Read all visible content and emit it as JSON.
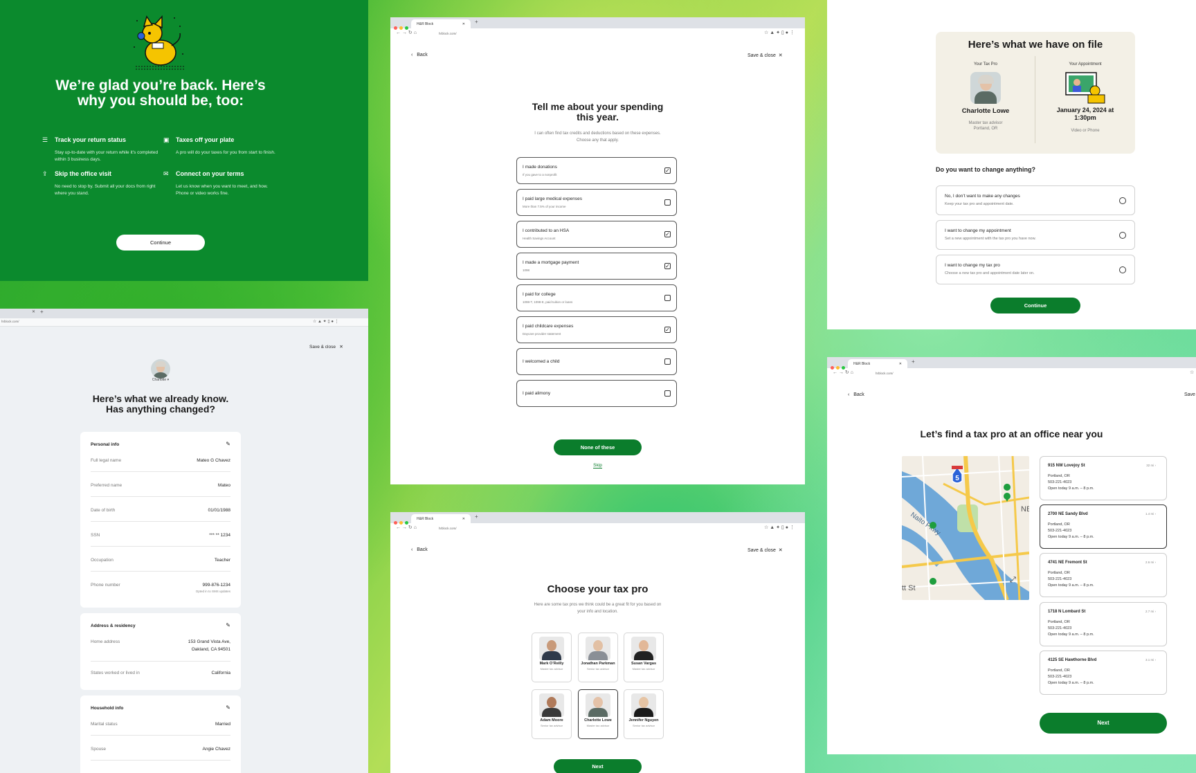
{
  "colors": {
    "brand_green": "#0b8a2d",
    "button_green": "#0b7d2c",
    "map_water": "#6fa8d8"
  },
  "welcome": {
    "title_line1": "We’re glad you’re back. Here’s",
    "title_line2": "why you should be, too:",
    "features": [
      {
        "icon": "checklist-icon",
        "title": "Track your return status",
        "desc": "Stay up-to-date with your return while it’s completed within 3 business days."
      },
      {
        "icon": "plate-icon",
        "title": "Taxes off your plate",
        "desc": "A pro will do your taxes for you from start to finish."
      },
      {
        "icon": "upload-icon",
        "title": "Skip the office visit",
        "desc": "No need to stop by. Submit all your docs from right where you stand."
      },
      {
        "icon": "chat-icon",
        "title": "Connect on your terms",
        "desc": "Let us know when you want to meet, and how. Phone or video works fine."
      }
    ],
    "continue_label": "Continue"
  },
  "browser": {
    "tab_title": "H&R Block",
    "url": "hrblock.com/"
  },
  "nav": {
    "back": "Back",
    "save_close": "Save & close",
    "save": "Save"
  },
  "spending": {
    "title_line1": "Tell me about your spending",
    "title_line2": "this year.",
    "subtitle_line1": "I can often find tax credits and deductions based on these expenses.",
    "subtitle_line2": "Choose any that apply.",
    "options": [
      {
        "title": "I made donations",
        "sub": "If you gave to a nonprofit",
        "checked": "✓"
      },
      {
        "title": "I paid large medical expenses",
        "sub": "More than 7.5% of your income",
        "checked": ""
      },
      {
        "title": "I contributed to an HSA",
        "sub": "Health Savings Account",
        "checked": "✓"
      },
      {
        "title": "I made a mortgage payment",
        "sub": "1098",
        "checked": "✓"
      },
      {
        "title": "I paid for college",
        "sub": "1098-T, 1098-E, paid tuition or loans",
        "checked": ""
      },
      {
        "title": "I paid childcare expenses",
        "sub": "Daycare provider statement",
        "checked": "✓"
      },
      {
        "title": "I welcomed a child",
        "sub": "",
        "checked": ""
      },
      {
        "title": "I paid alimony",
        "sub": "",
        "checked": ""
      }
    ],
    "none_label": "None of these",
    "skip_label": "Skip"
  },
  "on_file": {
    "title": "Here’s what we have on file",
    "tax_pro_label": "Your Tax Pro",
    "appt_label": "Your Appointment",
    "pro_name": "Charlotte Lowe",
    "pro_role": "Master tax advisor",
    "pro_city": "Portland, OR",
    "appt_date_line1": "January 24, 2024 at",
    "appt_date_line2": "1:30pm",
    "appt_mode": "Video or Phone",
    "question": "Do you want to change anything?",
    "options": [
      {
        "title": "No, I don’t want to make any changes",
        "sub": "Keep your tax pro and appointment date."
      },
      {
        "title": "I want to change my appointment",
        "sub": "Set a new appointment with the tax pro you have now."
      },
      {
        "title": "I want to change my tax pro",
        "sub": "Choose a new tax pro and appointment date later on."
      }
    ],
    "continue_label": "Continue"
  },
  "already_know": {
    "avatar_name": "Charlotte",
    "title_line1": "Here’s what we already know.",
    "title_line2": "Has anything changed?",
    "personal": {
      "heading": "Personal info",
      "rows": [
        {
          "k": "Full legal name",
          "v": "Mateo G Chavez",
          "v2": ""
        },
        {
          "k": "Preferred name",
          "v": "Mateo",
          "v2": ""
        },
        {
          "k": "Date of birth",
          "v": "01/01/1988",
          "v2": ""
        },
        {
          "k": "SSN",
          "v": "*** ** 1234",
          "v2": ""
        },
        {
          "k": "Occupation",
          "v": "Teacher",
          "v2": ""
        },
        {
          "k": "Phone number",
          "v": "999-876-1234",
          "v2": "Opted in to SMS updates"
        }
      ]
    },
    "address": {
      "heading": "Address & residency",
      "rows": [
        {
          "k": "Home address",
          "v": "153 Grand Vista Ave,",
          "v2": "Oakland, CA 94501"
        },
        {
          "k": "States worked or lived in",
          "v": "California",
          "v2": ""
        }
      ]
    },
    "household": {
      "heading": "Household info",
      "rows": [
        {
          "k": "Marital status",
          "v": "Married",
          "v2": ""
        },
        {
          "k": "Spouse",
          "v": "Angie Chavez",
          "v2": ""
        }
      ]
    }
  },
  "choose_pro": {
    "title": "Choose your tax pro",
    "subtitle_line1": "Here are some tax pros we think could be a great fit for you based on",
    "subtitle_line2": "your info and location.",
    "pros": [
      {
        "name": "Mark O’Reilly",
        "role": "Master tax advisor"
      },
      {
        "name": "Jonathan Parkman",
        "role": "Senior tax advisor"
      },
      {
        "name": "Susan Vargas",
        "role": "Master tax advisor"
      },
      {
        "name": "Adam Moore",
        "role": "Senior tax advisor"
      },
      {
        "name": "Charlotte Lowe",
        "role": "Master tax advisor"
      },
      {
        "name": "Jennifer Nguyen",
        "role": "Senior tax advisor"
      }
    ],
    "next_label": "Next"
  },
  "find_office": {
    "title": "Let’s find a tax pro at an office near you",
    "map_labels": {
      "highway": "5",
      "ne": "NE",
      "street": "Naito Pkwy",
      "st": "tt St"
    },
    "locations": [
      {
        "addr": "915 NW Lovejoy St",
        "dist": "32 mi",
        "city": "Portland, OR",
        "phone": "503-221-4023",
        "hours": "Open today 9 a.m. – 8 p.m."
      },
      {
        "addr": "2700 NE Sandy Blvd",
        "dist": "1.4 mi",
        "city": "Portland, OR",
        "phone": "503-221-4023",
        "hours": "Open today 9 a.m. – 8 p.m."
      },
      {
        "addr": "4741 NE Fremont St",
        "dist": "2.6 mi",
        "city": "Portland, OR",
        "phone": "503-221-4023",
        "hours": "Open today 9 a.m. – 8 p.m."
      },
      {
        "addr": "1718 N Lombard St",
        "dist": "2.7 mi",
        "city": "Portland, OR",
        "phone": "503-221-4023",
        "hours": "Open today 9 a.m. – 8 p.m."
      },
      {
        "addr": "4125 SE Hawthorne Blvd",
        "dist": "3.1 mi",
        "city": "Portland, OR",
        "phone": "503-221-4023",
        "hours": "Open today 9 a.m. – 8 p.m."
      }
    ],
    "next_label": "Next"
  }
}
